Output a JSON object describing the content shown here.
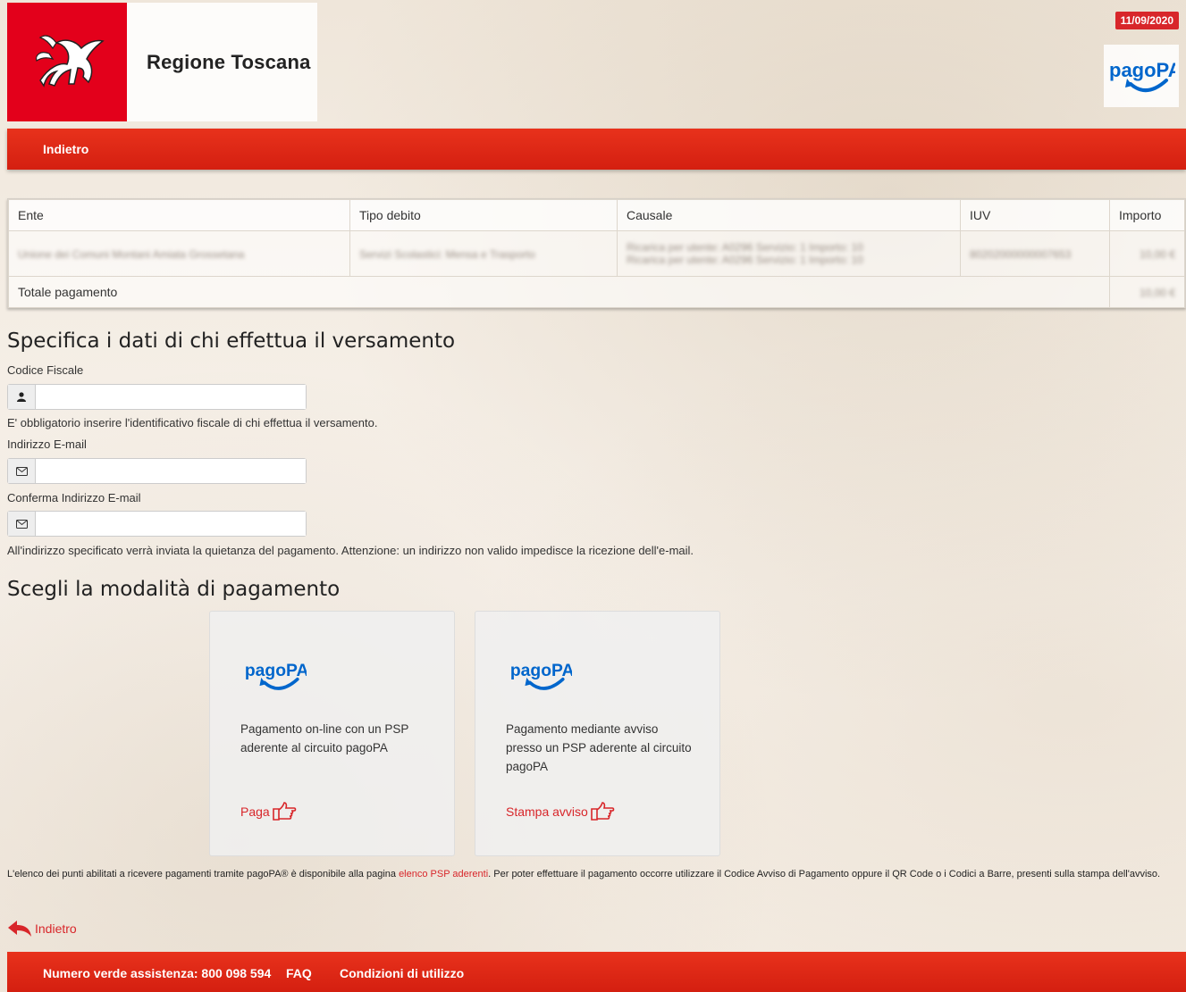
{
  "header": {
    "brand": "Regione Toscana",
    "date": "11/09/2020",
    "pagopa_logo_text": "pagoPA"
  },
  "nav": {
    "back_label": "Indietro"
  },
  "table": {
    "columns": [
      "Ente",
      "Tipo debito",
      "Causale",
      "IUV",
      "Importo"
    ],
    "row": {
      "ente": "Unione dei Comuni Montani Amiata Grossetana",
      "tipo_debito": "Servizi Scolastici: Mensa e Trasporto",
      "causale_line1": "Ricarica per utente: A0296 Servizio: 1 Importo: 10",
      "causale_line2": "Ricarica per utente: A0296 Servizio: 1 Importo: 10",
      "iuv": "80202000000007653",
      "importo": "10,00 €"
    },
    "total_label": "Totale pagamento",
    "total_value": "10,00 €"
  },
  "payer": {
    "title": "Specifica i dati di chi effettua il versamento",
    "codice_fiscale_label": "Codice Fiscale",
    "codice_fiscale_help": "E' obbligatorio inserire l'identificativo fiscale di chi effettua il versamento.",
    "email_label": "Indirizzo E-mail",
    "email_confirm_label": "Conferma Indirizzo E-mail",
    "email_help": "All'indirizzo specificato verrà inviata la quietanza del pagamento. Attenzione: un indirizzo non valido impedisce la ricezione dell'e-mail."
  },
  "payment": {
    "title": "Scegli la modalità di pagamento",
    "online": {
      "description": "Pagamento on-line con un PSP aderente al circuito pagoPA",
      "action": "Paga"
    },
    "notice": {
      "description": "Pagamento mediante avviso presso un PSP aderente al circuito pagoPA",
      "action": "Stampa avviso"
    }
  },
  "info": {
    "text_before": "L'elenco dei punti abilitati a ricevere pagamenti tramite pagoPA® è disponibile alla pagina ",
    "link": "elenco PSP aderenti",
    "text_after": ". Per poter effettuare il pagamento occorre utilizzare il Codice Avviso di Pagamento oppure il QR Code o i Codici a Barre, presenti sulla stampa dell'avviso."
  },
  "back_bottom": "Indietro",
  "footer": {
    "assistance": "Numero verde assistenza: 800 098 594",
    "faq": "FAQ",
    "terms": "Condizioni di utilizzo"
  },
  "colors": {
    "accent": "#d8262a",
    "nav_red": "#e8321c",
    "pagopa_blue": "#0066cc"
  }
}
